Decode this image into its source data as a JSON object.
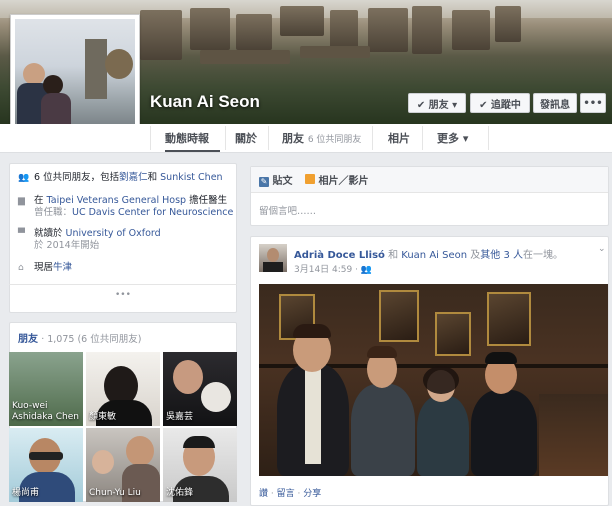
{
  "profile": {
    "name": "Kuan Ai Seon",
    "buttons": {
      "friends": "✔ 朋友 ▾",
      "following": "✔ 追蹤中",
      "message": "發訊息",
      "more": "•••"
    }
  },
  "tabs": [
    {
      "label": "動態時報"
    },
    {
      "label": "關於"
    },
    {
      "label": "朋友",
      "sub": "6 位共同朋友"
    },
    {
      "label": "相片"
    },
    {
      "label": "更多 ▾"
    }
  ],
  "intro": {
    "mutual_prefix": "6 位共同朋友，包括",
    "mutual_name1": "劉嘉仁",
    "mutual_mid": "和",
    "mutual_name2": "Sunkist Chen",
    "work_prefix": "在",
    "work_place": "Taipei Veterans General Hosp",
    "work_role": "擔任醫生",
    "work_former_prefix": "曾任職：",
    "work_former": "UC Davis Center for Neuroscience",
    "study_prefix": "就讀於",
    "study_place": "University of Oxford",
    "study_since": "於 2014年開始",
    "lives_prefix": "現居",
    "lives_place": "牛津",
    "more": "•••"
  },
  "friends": {
    "title": "朋友",
    "count": "· 1,075 (6 位共同朋友)",
    "items": [
      {
        "name": "Kuo-wei Ashidaka Chen"
      },
      {
        "name": "顏東敏"
      },
      {
        "name": "吳嘉芸"
      },
      {
        "name": "楊尚甫"
      },
      {
        "name": "Chun-Yu Liu"
      },
      {
        "name": "沈佑鋒"
      }
    ]
  },
  "composer": {
    "status_label": "貼文",
    "photo_label": "相片／影片",
    "placeholder": "留個言吧……"
  },
  "post": {
    "author": "Adrià Doce Llisó",
    "mid1": "和",
    "with": "Kuan Ai Seon",
    "mid2": "及",
    "others": "其他 3 人",
    "tail": "在一塊。",
    "date": "3月14日 4:59 · ",
    "actions": {
      "like": "讚",
      "comment": "留言",
      "share": "分享"
    }
  },
  "colors": {
    "link": "#365899",
    "bg": "#e9ebee",
    "text": "#1d2129"
  }
}
